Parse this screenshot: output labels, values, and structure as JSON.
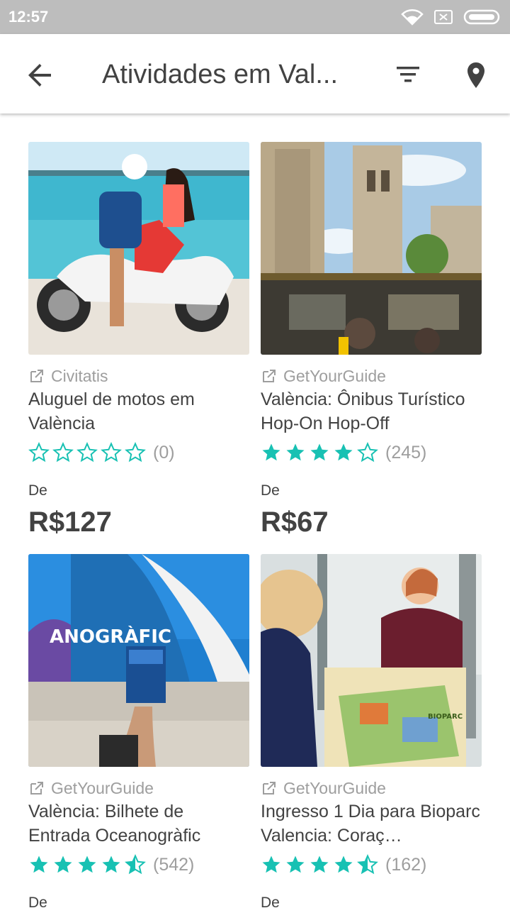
{
  "status_bar": {
    "time": "12:57"
  },
  "app_bar": {
    "title": "Atividades em Val..."
  },
  "colors": {
    "accent": "#18c1b3",
    "muted": "#9e9e9e",
    "text": "#424242"
  },
  "cards": [
    {
      "provider": "Civitatis",
      "title": "Aluguel de motos em València",
      "rating": 0,
      "reviews": "(0)",
      "price_label": "De",
      "price": "R$127",
      "image": "scooter-by-sea"
    },
    {
      "provider": "GetYourGuide",
      "title": "València: Ônibus Turístico Hop-On Hop-Off",
      "rating": 4,
      "reviews": "(245)",
      "price_label": "De",
      "price": "R$67",
      "image": "bus-tour-tower"
    },
    {
      "provider": "GetYourGuide",
      "title": "València: Bilhete de Entrada Oceanogràfic",
      "rating": 4.5,
      "reviews": "(542)",
      "price_label": "De",
      "price": "",
      "image": "oceanografic-ticket"
    },
    {
      "provider": "GetYourGuide",
      "title": "Ingresso 1 Dia para Bioparc Valencia: Coraç…",
      "rating": 4.5,
      "reviews": "(162)",
      "price_label": "De",
      "price": "",
      "image": "bioparc-map"
    }
  ]
}
